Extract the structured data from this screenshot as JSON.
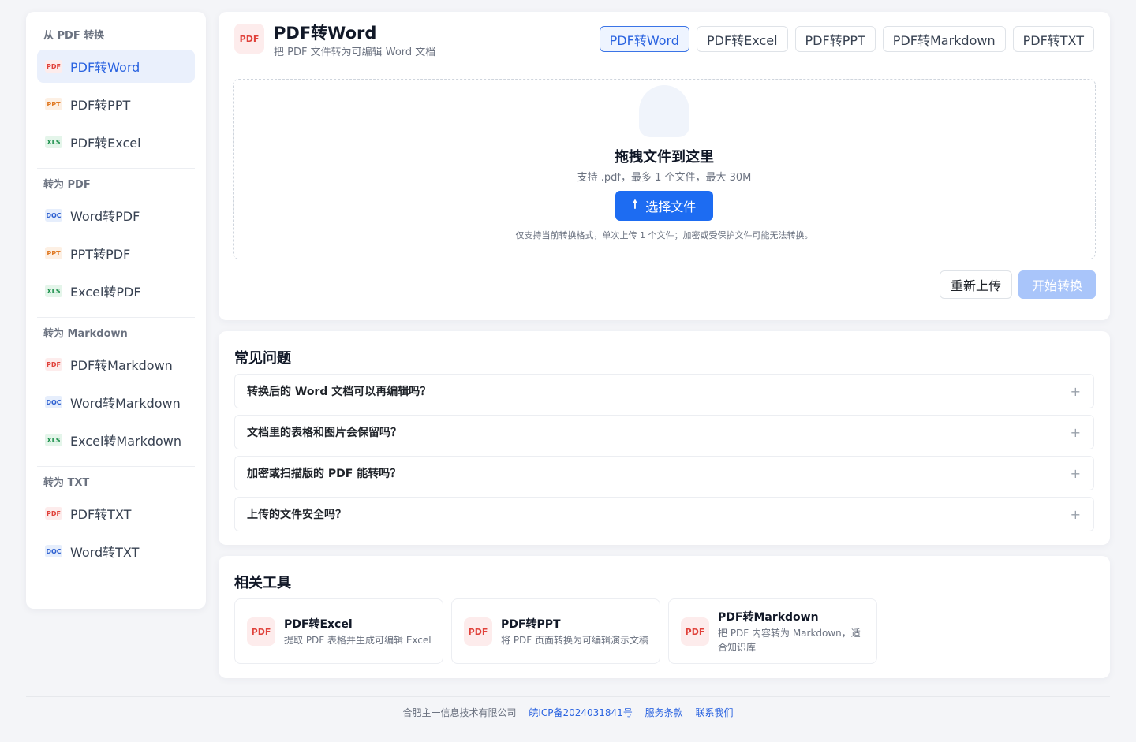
{
  "sidebar": {
    "groups": [
      {
        "title": "从 PDF 转换",
        "items": [
          {
            "badge": "PDF",
            "label": "PDF转Word",
            "active": true,
            "kind": "pdf"
          },
          {
            "badge": "PPT",
            "label": "PDF转PPT",
            "kind": "ppt"
          },
          {
            "badge": "XLS",
            "label": "PDF转Excel",
            "kind": "xls"
          }
        ]
      },
      {
        "title": "转为 PDF",
        "items": [
          {
            "badge": "DOC",
            "label": "Word转PDF",
            "kind": "doc"
          },
          {
            "badge": "PPT",
            "label": "PPT转PDF",
            "kind": "ppt"
          },
          {
            "badge": "XLS",
            "label": "Excel转PDF",
            "kind": "xls"
          }
        ]
      },
      {
        "title": "转为 Markdown",
        "items": [
          {
            "badge": "PDF",
            "label": "PDF转Markdown",
            "kind": "pdf"
          },
          {
            "badge": "DOC",
            "label": "Word转Markdown",
            "kind": "doc"
          },
          {
            "badge": "XLS",
            "label": "Excel转Markdown",
            "kind": "xls"
          }
        ]
      },
      {
        "title": "转为 TXT",
        "items": [
          {
            "badge": "PDF",
            "label": "PDF转TXT",
            "kind": "pdf"
          },
          {
            "badge": "DOC",
            "label": "Word转TXT",
            "kind": "doc"
          }
        ]
      }
    ]
  },
  "header": {
    "logo": "PDF",
    "title": "PDF转Word",
    "subtitle": "把 PDF 文件转为可编辑 Word 文档",
    "tabs": [
      "PDF转Word",
      "PDF转Excel",
      "PDF转PPT",
      "PDF转Markdown",
      "PDF转TXT"
    ],
    "active_tab": 0
  },
  "upload": {
    "title": "拖拽文件到这里",
    "hint": "支持 .pdf，最多 1 个文件，最大 30M",
    "button_icon": "upload-arrow-icon",
    "button_label": "选择文件",
    "note": "仅支持当前转换格式，单次上传 1 个文件；加密或受保护文件可能无法转换。"
  },
  "actions": {
    "reupload": "重新上传",
    "start": "开始转换"
  },
  "faq": {
    "title": "常见问题",
    "items": [
      "转换后的 Word 文档可以再编辑吗？",
      "文档里的表格和图片会保留吗？",
      "加密或扫描版的 PDF 能转吗？",
      "上传的文件安全吗？"
    ],
    "expand_symbol": "+"
  },
  "tools": {
    "title": "相关工具",
    "items": [
      {
        "icon": "PDF",
        "name": "PDF转Excel",
        "desc": "提取 PDF 表格并生成可编辑 Excel"
      },
      {
        "icon": "PDF",
        "name": "PDF转PPT",
        "desc": "将 PDF 页面转换为可编辑演示文稿"
      },
      {
        "icon": "PDF",
        "name": "PDF转Markdown",
        "desc": "把 PDF 内容转为 Markdown，适合知识库"
      }
    ]
  },
  "footer": {
    "company": "合肥主一信息技术有限公司",
    "icp": "皖ICP备2024031841号",
    "terms": "服务条款",
    "contact": "联系我们"
  },
  "colors": {
    "accent": "#1d6cf2",
    "pdf": "#e0413a",
    "ppt": "#e07a25",
    "xls": "#1a8f4a",
    "doc": "#2c5fd0"
  }
}
